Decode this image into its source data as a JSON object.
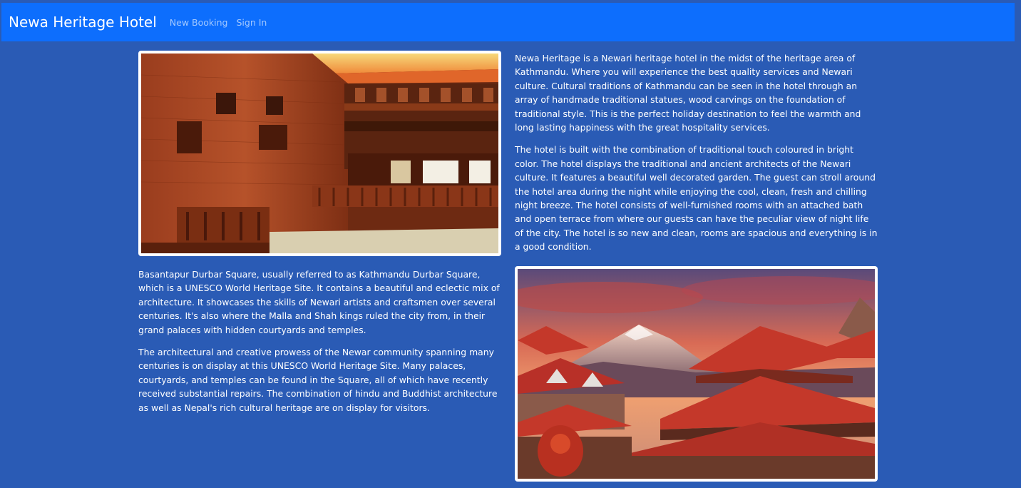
{
  "navbar": {
    "brand": "Newa Heritage Hotel",
    "links": [
      "New Booking",
      "Sign In"
    ]
  },
  "about": {
    "p1": "Newa Heritage is a Newari heritage hotel in the midst of the heritage area of Kathmandu. Where you will experience the best quality services and Newari culture. Cultural traditions of Kathmandu can be seen in the hotel through an array of handmade traditional statues, wood carvings on the foundation of traditional style. This is the perfect holiday destination to feel the warmth and long lasting happiness with the great hospitality services.",
    "p2": "The hotel is built with the combination of traditional touch coloured in bright color. The hotel displays the traditional and ancient architects of the Newari culture. It features a beautiful well decorated garden. The guest can stroll around the hotel area during the night while enjoying the cool, clean, fresh and chilling night breeze. The hotel consists of well-furnished rooms with an attached bath and open terrace from where our guests can have the peculiar view of night life of the city. The hotel is so new and clean, rooms are spacious and everything is in a good condition."
  },
  "durbar": {
    "p1": "Basantapur Durbar Square, usually referred to as Kathmandu Durbar Square, which is a UNESCO World Heritage Site. It contains a beautiful and eclectic mix of architecture. It showcases the skills of Newari artists and craftsmen over several centuries. It's also where the Malla and Shah kings ruled the city from, in their grand palaces with hidden courtyards and temples.",
    "p2": "The architectural and creative prowess of the Newar community spanning many centuries is on display at this UNESCO World Heritage Site. Many palaces, courtyards, and temples can be found in the Square, all of which have recently received substantial repairs. The combination of hindu and Buddhist architecture as well as Nepal's rich cultural heritage are on display for visitors."
  },
  "colors": {
    "background": "#2a5bb5",
    "navbar": "#0d6efd"
  }
}
